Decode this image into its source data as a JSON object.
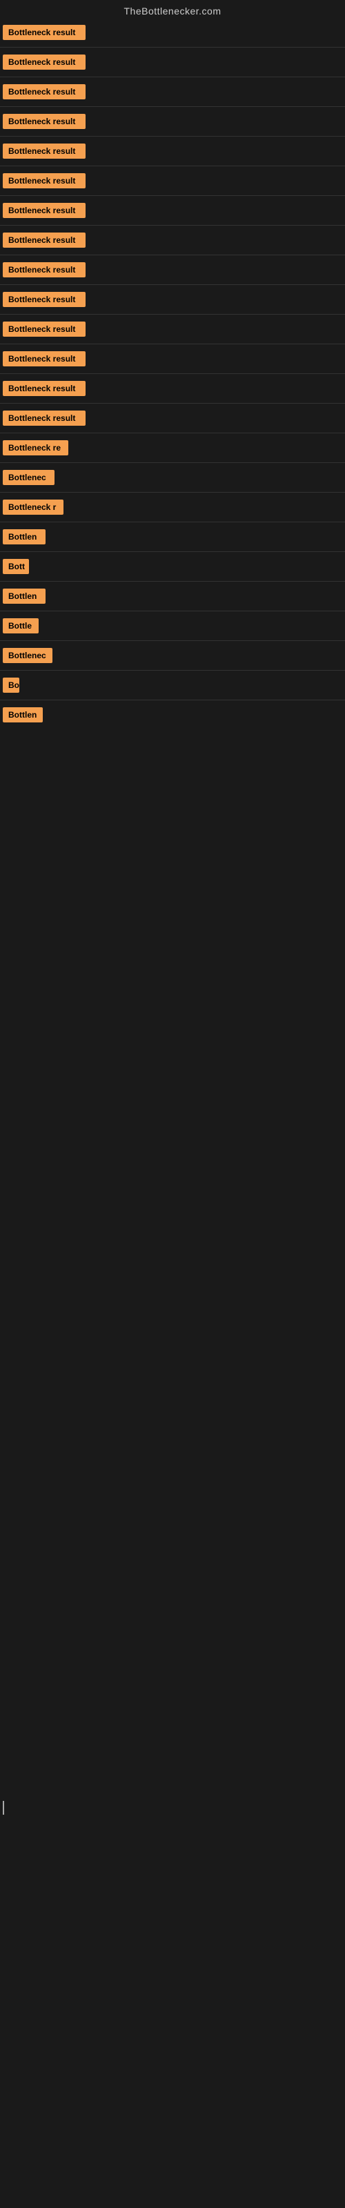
{
  "header": {
    "title": "TheBottlenecker.com"
  },
  "items": [
    {
      "id": 1,
      "label": "Bottleneck result",
      "width": 120
    },
    {
      "id": 2,
      "label": "Bottleneck result",
      "width": 120
    },
    {
      "id": 3,
      "label": "Bottleneck result",
      "width": 120
    },
    {
      "id": 4,
      "label": "Bottleneck result",
      "width": 120
    },
    {
      "id": 5,
      "label": "Bottleneck result",
      "width": 120
    },
    {
      "id": 6,
      "label": "Bottleneck result",
      "width": 120
    },
    {
      "id": 7,
      "label": "Bottleneck result",
      "width": 120
    },
    {
      "id": 8,
      "label": "Bottleneck result",
      "width": 120
    },
    {
      "id": 9,
      "label": "Bottleneck result",
      "width": 120
    },
    {
      "id": 10,
      "label": "Bottleneck result",
      "width": 120
    },
    {
      "id": 11,
      "label": "Bottleneck result",
      "width": 120
    },
    {
      "id": 12,
      "label": "Bottleneck result",
      "width": 120
    },
    {
      "id": 13,
      "label": "Bottleneck result",
      "width": 120
    },
    {
      "id": 14,
      "label": "Bottleneck result",
      "width": 120
    },
    {
      "id": 15,
      "label": "Bottleneck re",
      "width": 95
    },
    {
      "id": 16,
      "label": "Bottlenec",
      "width": 75
    },
    {
      "id": 17,
      "label": "Bottleneck r",
      "width": 88
    },
    {
      "id": 18,
      "label": "Bottlen",
      "width": 62
    },
    {
      "id": 19,
      "label": "Bott",
      "width": 38
    },
    {
      "id": 20,
      "label": "Bottlen",
      "width": 62
    },
    {
      "id": 21,
      "label": "Bottle",
      "width": 52
    },
    {
      "id": 22,
      "label": "Bottlenec",
      "width": 72
    },
    {
      "id": 23,
      "label": "Bo",
      "width": 24
    },
    {
      "id": 24,
      "label": "Bottlen",
      "width": 58
    }
  ],
  "colors": {
    "badge_bg": "#f5a050",
    "badge_text": "#000000",
    "bg": "#1a1a1a",
    "title": "#cccccc",
    "divider": "#333333"
  }
}
